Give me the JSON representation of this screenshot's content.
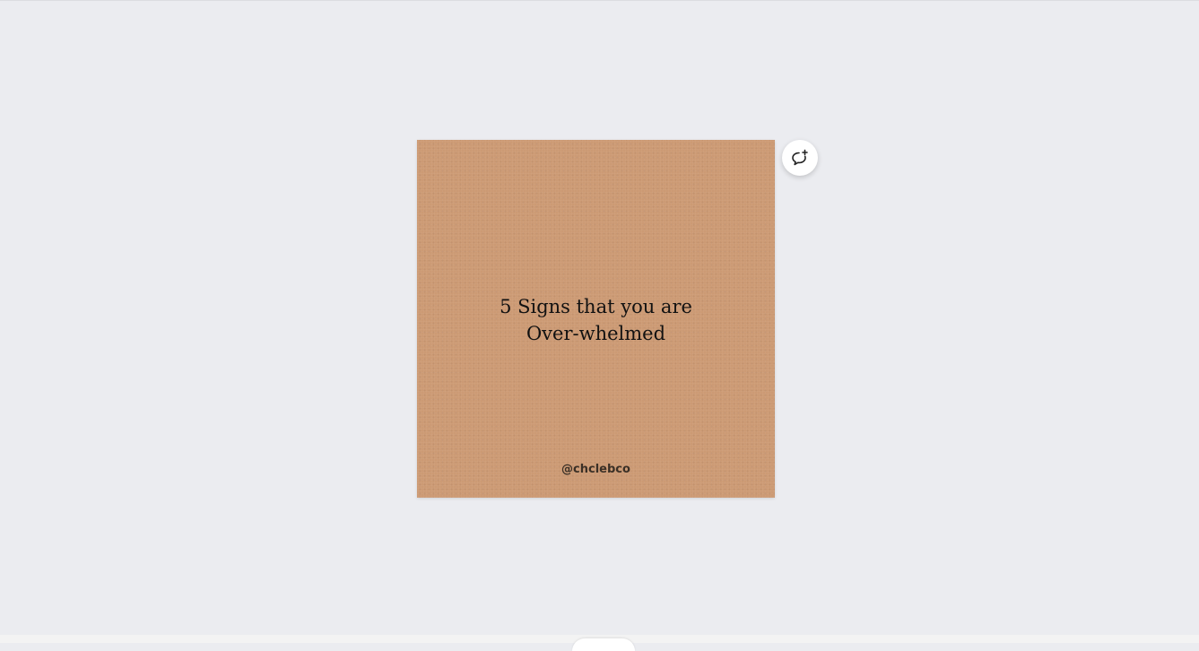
{
  "canvas": {
    "background_color": "#cc9a74",
    "headline_line1": "5 Signs that you are",
    "headline_line2": "Over-whelmed",
    "handle": "@chclebco"
  },
  "toolbar": {
    "add_comment_icon": "comment-plus-icon"
  },
  "colors": {
    "workspace": "#ebecf0",
    "page": "#cc9a74",
    "text": "#111111"
  }
}
